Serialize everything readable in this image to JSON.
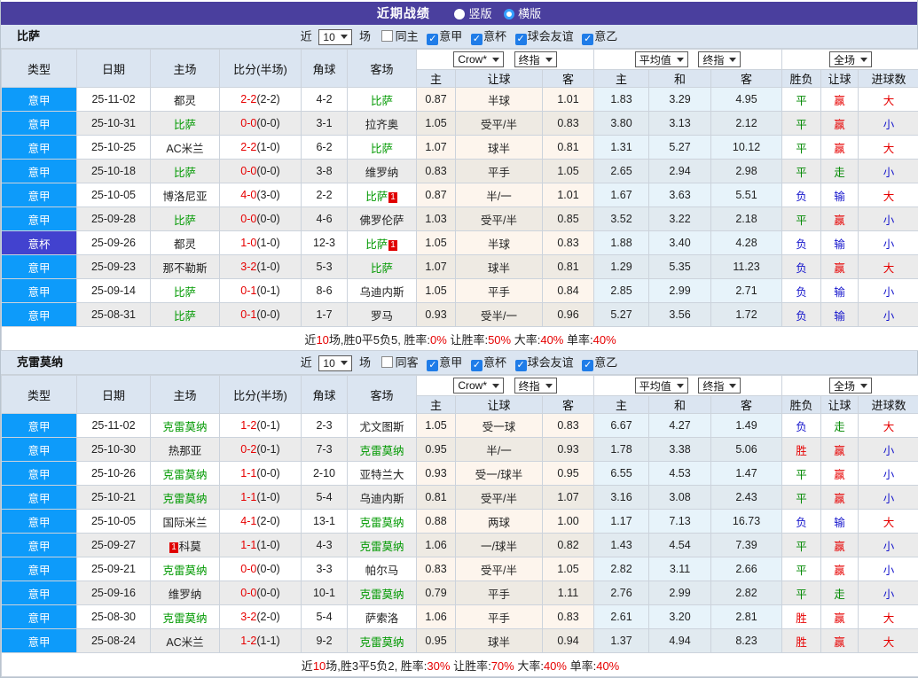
{
  "header": {
    "title": "近期战绩",
    "radios": [
      {
        "label": "竖版",
        "selected": false
      },
      {
        "label": "横版",
        "selected": true
      }
    ]
  },
  "colors": {
    "topbar_bg": "#4a3f9e",
    "league_blue": "#0d9bfa",
    "league_purple": "#4242cf",
    "team_green": "#009900",
    "win_red": "#e60000",
    "draw_green": "#008800",
    "lose_blue": "#1515cc"
  },
  "filter_labels": {
    "near": "近",
    "count": "10",
    "games": "场",
    "leagues": [
      "意甲",
      "意杯",
      "球会友谊",
      "意乙"
    ]
  },
  "table_header": {
    "cols": [
      "类型",
      "日期",
      "主场",
      "比分(半场)",
      "角球",
      "客场"
    ],
    "dropdowns": {
      "crow": "Crow*",
      "final1": "终指",
      "avg": "平均值",
      "final2": "终指",
      "full": "全场"
    },
    "sub_cols": [
      "主",
      "让球",
      "客",
      "主",
      "和",
      "客",
      "胜负",
      "让球",
      "进球数"
    ]
  },
  "tables": [
    {
      "team": "比萨",
      "same_label": "同主",
      "rows": [
        {
          "league": "意甲",
          "league_style": "blue",
          "date": "25-11-02",
          "home": {
            "name": "都灵",
            "green": false
          },
          "score": "2-2",
          "half": "(2-2)",
          "corner": "4-2",
          "away": {
            "name": "比萨",
            "green": true
          },
          "crow": [
            "0.87",
            "半球",
            "1.01"
          ],
          "avg": [
            "1.83",
            "3.29",
            "4.95"
          ],
          "results": [
            {
              "t": "平",
              "c": "g"
            },
            {
              "t": "赢",
              "c": "r"
            },
            {
              "t": "大",
              "c": "r"
            }
          ]
        },
        {
          "league": "意甲",
          "league_style": "blue",
          "date": "25-10-31",
          "home": {
            "name": "比萨",
            "green": true
          },
          "score": "0-0",
          "half": "(0-0)",
          "corner": "3-1",
          "away": {
            "name": "拉齐奥",
            "green": false
          },
          "crow": [
            "1.05",
            "受平/半",
            "0.83"
          ],
          "avg": [
            "3.80",
            "3.13",
            "2.12"
          ],
          "results": [
            {
              "t": "平",
              "c": "g"
            },
            {
              "t": "赢",
              "c": "r"
            },
            {
              "t": "小",
              "c": "b"
            }
          ]
        },
        {
          "league": "意甲",
          "league_style": "blue",
          "date": "25-10-25",
          "home": {
            "name": "AC米兰",
            "green": false
          },
          "score": "2-2",
          "half": "(1-0)",
          "corner": "6-2",
          "away": {
            "name": "比萨",
            "green": true
          },
          "crow": [
            "1.07",
            "球半",
            "0.81"
          ],
          "avg": [
            "1.31",
            "5.27",
            "10.12"
          ],
          "results": [
            {
              "t": "平",
              "c": "g"
            },
            {
              "t": "赢",
              "c": "r"
            },
            {
              "t": "大",
              "c": "r"
            }
          ]
        },
        {
          "league": "意甲",
          "league_style": "blue",
          "date": "25-10-18",
          "home": {
            "name": "比萨",
            "green": true
          },
          "score": "0-0",
          "half": "(0-0)",
          "corner": "3-8",
          "away": {
            "name": "维罗纳",
            "green": false
          },
          "crow": [
            "0.83",
            "平手",
            "1.05"
          ],
          "avg": [
            "2.65",
            "2.94",
            "2.98"
          ],
          "results": [
            {
              "t": "平",
              "c": "g"
            },
            {
              "t": "走",
              "c": "g"
            },
            {
              "t": "小",
              "c": "b"
            }
          ]
        },
        {
          "league": "意甲",
          "league_style": "blue",
          "date": "25-10-05",
          "home": {
            "name": "博洛尼亚",
            "green": false
          },
          "score": "4-0",
          "half": "(3-0)",
          "corner": "2-2",
          "away": {
            "name": "比萨",
            "green": true,
            "badge": "1",
            "badge_pos": "post"
          },
          "crow": [
            "0.87",
            "半/一",
            "1.01"
          ],
          "avg": [
            "1.67",
            "3.63",
            "5.51"
          ],
          "results": [
            {
              "t": "负",
              "c": "b"
            },
            {
              "t": "输",
              "c": "b"
            },
            {
              "t": "大",
              "c": "r"
            }
          ]
        },
        {
          "league": "意甲",
          "league_style": "blue",
          "date": "25-09-28",
          "home": {
            "name": "比萨",
            "green": true
          },
          "score": "0-0",
          "half": "(0-0)",
          "corner": "4-6",
          "away": {
            "name": "佛罗伦萨",
            "green": false
          },
          "crow": [
            "1.03",
            "受平/半",
            "0.85"
          ],
          "avg": [
            "3.52",
            "3.22",
            "2.18"
          ],
          "results": [
            {
              "t": "平",
              "c": "g"
            },
            {
              "t": "赢",
              "c": "r"
            },
            {
              "t": "小",
              "c": "b"
            }
          ]
        },
        {
          "league": "意杯",
          "league_style": "purple",
          "date": "25-09-26",
          "home": {
            "name": "都灵",
            "green": false
          },
          "score": "1-0",
          "half": "(1-0)",
          "corner": "12-3",
          "away": {
            "name": "比萨",
            "green": true,
            "badge": "1",
            "badge_pos": "post"
          },
          "crow": [
            "1.05",
            "半球",
            "0.83"
          ],
          "avg": [
            "1.88",
            "3.40",
            "4.28"
          ],
          "results": [
            {
              "t": "负",
              "c": "b"
            },
            {
              "t": "输",
              "c": "b"
            },
            {
              "t": "小",
              "c": "b"
            }
          ]
        },
        {
          "league": "意甲",
          "league_style": "blue",
          "date": "25-09-23",
          "home": {
            "name": "那不勒斯",
            "green": false
          },
          "score": "3-2",
          "half": "(1-0)",
          "corner": "5-3",
          "away": {
            "name": "比萨",
            "green": true
          },
          "crow": [
            "1.07",
            "球半",
            "0.81"
          ],
          "avg": [
            "1.29",
            "5.35",
            "11.23"
          ],
          "results": [
            {
              "t": "负",
              "c": "b"
            },
            {
              "t": "赢",
              "c": "r"
            },
            {
              "t": "大",
              "c": "r"
            }
          ]
        },
        {
          "league": "意甲",
          "league_style": "blue",
          "date": "25-09-14",
          "home": {
            "name": "比萨",
            "green": true
          },
          "score": "0-1",
          "half": "(0-1)",
          "corner": "8-6",
          "away": {
            "name": "乌迪内斯",
            "green": false
          },
          "crow": [
            "1.05",
            "平手",
            "0.84"
          ],
          "avg": [
            "2.85",
            "2.99",
            "2.71"
          ],
          "results": [
            {
              "t": "负",
              "c": "b"
            },
            {
              "t": "输",
              "c": "b"
            },
            {
              "t": "小",
              "c": "b"
            }
          ]
        },
        {
          "league": "意甲",
          "league_style": "blue",
          "date": "25-08-31",
          "home": {
            "name": "比萨",
            "green": true
          },
          "score": "0-1",
          "half": "(0-0)",
          "corner": "1-7",
          "away": {
            "name": "罗马",
            "green": false
          },
          "crow": [
            "0.93",
            "受半/一",
            "0.96"
          ],
          "avg": [
            "5.27",
            "3.56",
            "1.72"
          ],
          "results": [
            {
              "t": "负",
              "c": "b"
            },
            {
              "t": "输",
              "c": "b"
            },
            {
              "t": "小",
              "c": "b"
            }
          ]
        }
      ],
      "summary": [
        {
          "t": "近"
        },
        {
          "t": "10",
          "c": "r"
        },
        {
          "t": "场,胜0平5负5, 胜率:"
        },
        {
          "t": "0%",
          "c": "r"
        },
        {
          "t": " 让胜率:"
        },
        {
          "t": "50%",
          "c": "r"
        },
        {
          "t": " 大率:"
        },
        {
          "t": "40%",
          "c": "r"
        },
        {
          "t": " 单率:"
        },
        {
          "t": "40%",
          "c": "r"
        }
      ]
    },
    {
      "team": "克雷莫纳",
      "same_label": "同客",
      "rows": [
        {
          "league": "意甲",
          "league_style": "blue",
          "date": "25-11-02",
          "home": {
            "name": "克雷莫纳",
            "green": true
          },
          "score": "1-2",
          "half": "(0-1)",
          "corner": "2-3",
          "away": {
            "name": "尤文图斯",
            "green": false
          },
          "crow": [
            "1.05",
            "受一球",
            "0.83"
          ],
          "avg": [
            "6.67",
            "4.27",
            "1.49"
          ],
          "results": [
            {
              "t": "负",
              "c": "b"
            },
            {
              "t": "走",
              "c": "g"
            },
            {
              "t": "大",
              "c": "r"
            }
          ]
        },
        {
          "league": "意甲",
          "league_style": "blue",
          "date": "25-10-30",
          "home": {
            "name": "热那亚",
            "green": false
          },
          "score": "0-2",
          "half": "(0-1)",
          "corner": "7-3",
          "away": {
            "name": "克雷莫纳",
            "green": true
          },
          "crow": [
            "0.95",
            "半/一",
            "0.93"
          ],
          "avg": [
            "1.78",
            "3.38",
            "5.06"
          ],
          "results": [
            {
              "t": "胜",
              "c": "r"
            },
            {
              "t": "赢",
              "c": "r"
            },
            {
              "t": "小",
              "c": "b"
            }
          ]
        },
        {
          "league": "意甲",
          "league_style": "blue",
          "date": "25-10-26",
          "home": {
            "name": "克雷莫纳",
            "green": true
          },
          "score": "1-1",
          "half": "(0-0)",
          "corner": "2-10",
          "away": {
            "name": "亚特兰大",
            "green": false
          },
          "crow": [
            "0.93",
            "受一/球半",
            "0.95"
          ],
          "avg": [
            "6.55",
            "4.53",
            "1.47"
          ],
          "results": [
            {
              "t": "平",
              "c": "g"
            },
            {
              "t": "赢",
              "c": "r"
            },
            {
              "t": "小",
              "c": "b"
            }
          ]
        },
        {
          "league": "意甲",
          "league_style": "blue",
          "date": "25-10-21",
          "home": {
            "name": "克雷莫纳",
            "green": true
          },
          "score": "1-1",
          "half": "(1-0)",
          "corner": "5-4",
          "away": {
            "name": "乌迪内斯",
            "green": false
          },
          "crow": [
            "0.81",
            "受平/半",
            "1.07"
          ],
          "avg": [
            "3.16",
            "3.08",
            "2.43"
          ],
          "results": [
            {
              "t": "平",
              "c": "g"
            },
            {
              "t": "赢",
              "c": "r"
            },
            {
              "t": "小",
              "c": "b"
            }
          ]
        },
        {
          "league": "意甲",
          "league_style": "blue",
          "date": "25-10-05",
          "home": {
            "name": "国际米兰",
            "green": false
          },
          "score": "4-1",
          "half": "(2-0)",
          "corner": "13-1",
          "away": {
            "name": "克雷莫纳",
            "green": true
          },
          "crow": [
            "0.88",
            "两球",
            "1.00"
          ],
          "avg": [
            "1.17",
            "7.13",
            "16.73"
          ],
          "results": [
            {
              "t": "负",
              "c": "b"
            },
            {
              "t": "输",
              "c": "b"
            },
            {
              "t": "大",
              "c": "r"
            }
          ]
        },
        {
          "league": "意甲",
          "league_style": "blue",
          "date": "25-09-27",
          "home": {
            "name": "科莫",
            "green": false,
            "badge": "1",
            "badge_pos": "pre"
          },
          "score": "1-1",
          "half": "(1-0)",
          "corner": "4-3",
          "away": {
            "name": "克雷莫纳",
            "green": true
          },
          "crow": [
            "1.06",
            "一/球半",
            "0.82"
          ],
          "avg": [
            "1.43",
            "4.54",
            "7.39"
          ],
          "results": [
            {
              "t": "平",
              "c": "g"
            },
            {
              "t": "赢",
              "c": "r"
            },
            {
              "t": "小",
              "c": "b"
            }
          ]
        },
        {
          "league": "意甲",
          "league_style": "blue",
          "date": "25-09-21",
          "home": {
            "name": "克雷莫纳",
            "green": true
          },
          "score": "0-0",
          "half": "(0-0)",
          "corner": "3-3",
          "away": {
            "name": "帕尔马",
            "green": false
          },
          "crow": [
            "0.83",
            "受平/半",
            "1.05"
          ],
          "avg": [
            "2.82",
            "3.11",
            "2.66"
          ],
          "results": [
            {
              "t": "平",
              "c": "g"
            },
            {
              "t": "赢",
              "c": "r"
            },
            {
              "t": "小",
              "c": "b"
            }
          ]
        },
        {
          "league": "意甲",
          "league_style": "blue",
          "date": "25-09-16",
          "home": {
            "name": "维罗纳",
            "green": false
          },
          "score": "0-0",
          "half": "(0-0)",
          "corner": "10-1",
          "away": {
            "name": "克雷莫纳",
            "green": true
          },
          "crow": [
            "0.79",
            "平手",
            "1.11"
          ],
          "avg": [
            "2.76",
            "2.99",
            "2.82"
          ],
          "results": [
            {
              "t": "平",
              "c": "g"
            },
            {
              "t": "走",
              "c": "g"
            },
            {
              "t": "小",
              "c": "b"
            }
          ]
        },
        {
          "league": "意甲",
          "league_style": "blue",
          "date": "25-08-30",
          "home": {
            "name": "克雷莫纳",
            "green": true
          },
          "score": "3-2",
          "half": "(2-0)",
          "corner": "5-4",
          "away": {
            "name": "萨索洛",
            "green": false
          },
          "crow": [
            "1.06",
            "平手",
            "0.83"
          ],
          "avg": [
            "2.61",
            "3.20",
            "2.81"
          ],
          "results": [
            {
              "t": "胜",
              "c": "r"
            },
            {
              "t": "赢",
              "c": "r"
            },
            {
              "t": "大",
              "c": "r"
            }
          ]
        },
        {
          "league": "意甲",
          "league_style": "blue",
          "date": "25-08-24",
          "home": {
            "name": "AC米兰",
            "green": false
          },
          "score": "1-2",
          "half": "(1-1)",
          "corner": "9-2",
          "away": {
            "name": "克雷莫纳",
            "green": true
          },
          "crow": [
            "0.95",
            "球半",
            "0.94"
          ],
          "avg": [
            "1.37",
            "4.94",
            "8.23"
          ],
          "results": [
            {
              "t": "胜",
              "c": "r"
            },
            {
              "t": "赢",
              "c": "r"
            },
            {
              "t": "大",
              "c": "r"
            }
          ]
        }
      ],
      "summary": [
        {
          "t": "近"
        },
        {
          "t": "10",
          "c": "r"
        },
        {
          "t": "场,胜3平5负2, 胜率:"
        },
        {
          "t": "30%",
          "c": "r"
        },
        {
          "t": " 让胜率:"
        },
        {
          "t": "70%",
          "c": "r"
        },
        {
          "t": " 大率:"
        },
        {
          "t": "40%",
          "c": "r"
        },
        {
          "t": " 单率:"
        },
        {
          "t": "40%",
          "c": "r"
        }
      ]
    }
  ]
}
